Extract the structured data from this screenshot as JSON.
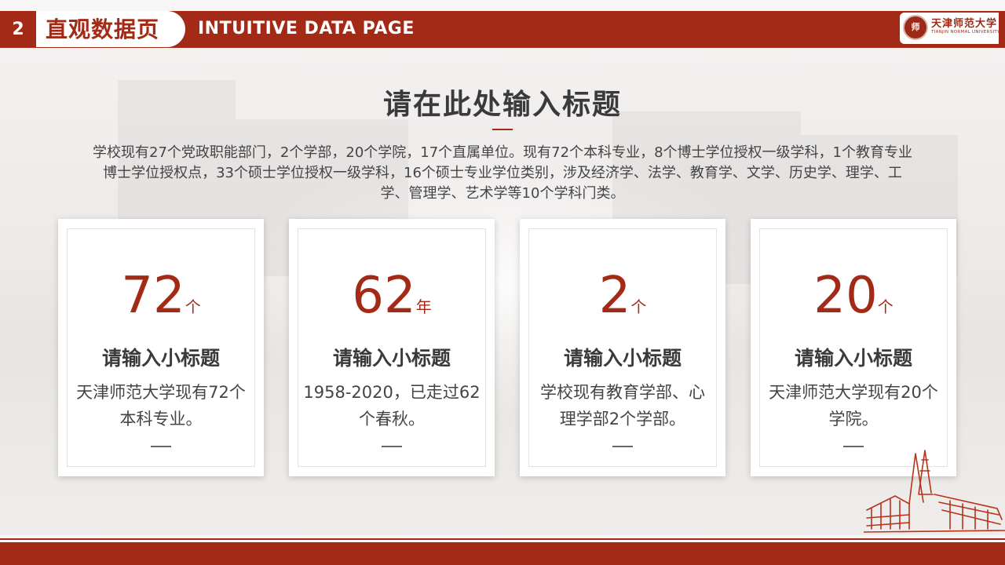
{
  "header": {
    "page_number": "2",
    "title_cn": "直观数据页",
    "title_en": "INTUITIVE DATA PAGE",
    "logo": {
      "seal_text": "师",
      "name": "天津师范大学",
      "name_en": "TIANJIN NORMAL UNIVERSITY"
    }
  },
  "main": {
    "title": "请在此处输入标题",
    "intro": "学校现有27个党政职能部门，2个学部，20个学院，17个直属单位。现有72个本科专业，8个博士学位授权一级学科，1个教育专业博士学位授权点，33个硕士学位授权一级学科，16个硕士专业学位类别，涉及经济学、法学、教育学、文学、历史学、理学、工学、管理学、艺术学等10个学科门类。"
  },
  "cards": [
    {
      "number": "72",
      "unit": "个",
      "subtitle": "请输入小标题",
      "desc": "天津师范大学现有72个本科专业。",
      "dash": "—"
    },
    {
      "number": "62",
      "unit": "年",
      "subtitle": "请输入小标题",
      "desc": "1958-2020，已走过62个春秋。",
      "dash": "—"
    },
    {
      "number": "2",
      "unit": "个",
      "subtitle": "请输入小标题",
      "desc": "学校现有教育学部、心理学部2个学部。",
      "dash": "—"
    },
    {
      "number": "20",
      "unit": "个",
      "subtitle": "请输入小标题",
      "desc": "天津师范大学现有20个学院。",
      "dash": "—"
    }
  ],
  "colors": {
    "accent": "#a32a16",
    "text_dark": "#3a3a3a",
    "text_body": "#444444",
    "background": "#f7f6f5"
  },
  "decor": {
    "sketch_icon": "building-sketch-icon"
  }
}
